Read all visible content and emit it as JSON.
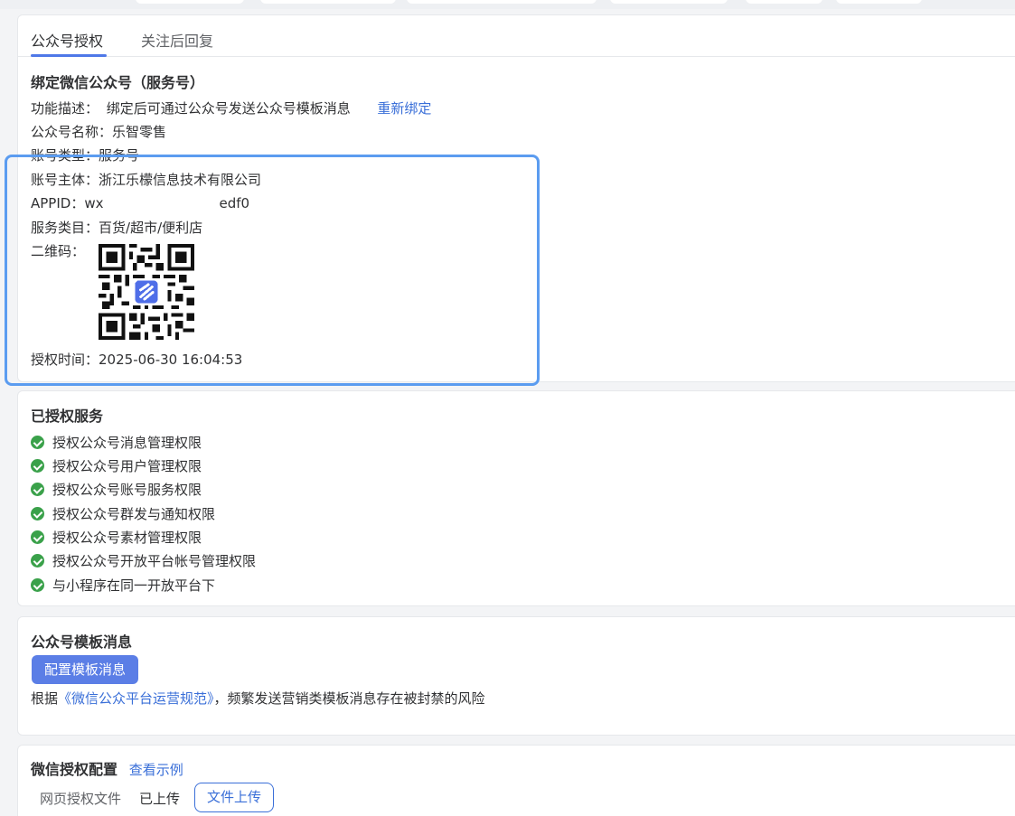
{
  "tabs": [
    {
      "label": "公众号授权",
      "active": true
    },
    {
      "label": "关注后回复",
      "active": false
    }
  ],
  "binding": {
    "title": "绑定微信公众号（服务号）",
    "desc_label": "功能描述：",
    "desc_value": "绑定后可通过公众号发送公众号模板消息",
    "rebind_link": "重新绑定",
    "name_label": "公众号名称：",
    "name_value": "乐智零售",
    "type_label": "账号类型：",
    "type_value": "服务号",
    "owner_label": "账号主体：",
    "owner_value": "浙江乐檬信息技术有限公司",
    "appid_label": "APPID：",
    "appid_prefix": "wx",
    "appid_suffix": "edf0",
    "category_label": "服务类目：",
    "category_value": "百货/超市/便利店",
    "qr_label": "二维码：",
    "auth_time_label": "授权时间：",
    "auth_time_value": "2025-06-30 16:04:53"
  },
  "services": {
    "title": "已授权服务",
    "items": [
      "授权公众号消息管理权限",
      "授权公众号用户管理权限",
      "授权公众号账号服务权限",
      "授权公众号群发与通知权限",
      "授权公众号素材管理权限",
      "授权公众号开放平台帐号管理权限",
      "与小程序在同一开放平台下"
    ]
  },
  "template": {
    "title": "公众号模板消息",
    "config_button": "配置模板消息",
    "notice_prefix": "根据",
    "notice_link": "《微信公众平台运营规范》",
    "notice_suffix": "，频繁发送营销类模板消息存在被封禁的风险"
  },
  "oauth": {
    "title": "微信授权配置",
    "example_link": "查看示例",
    "file_label": "网页授权文件",
    "file_status": "已上传",
    "upload_button": "文件上传"
  },
  "colors": {
    "accent": "#4f78e8",
    "success": "#3aa14a",
    "highlight": "#5b9cf0"
  }
}
